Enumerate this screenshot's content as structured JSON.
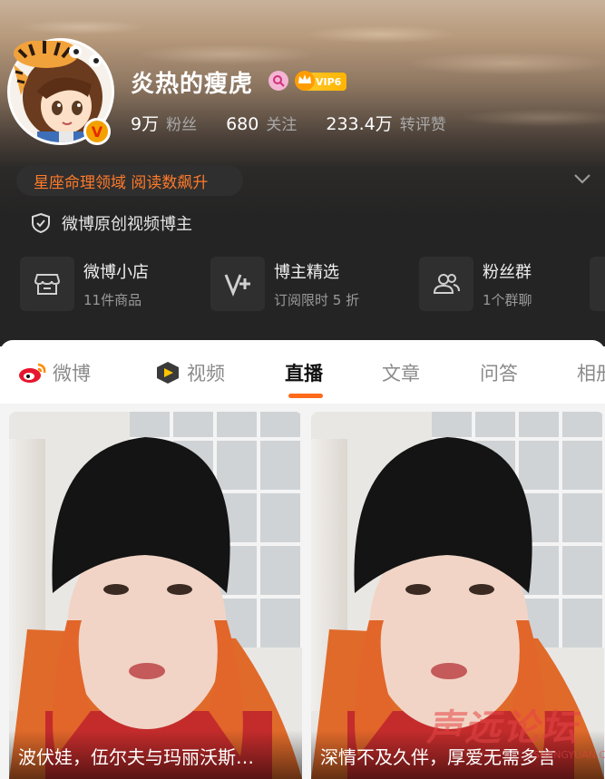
{
  "profile": {
    "username": "炎热的瘦虎",
    "vip_label": "VIP6",
    "verified_badge": "V",
    "stats": [
      {
        "value": "9万",
        "label": "粉丝"
      },
      {
        "value": "680",
        "label": "关注"
      },
      {
        "value": "233.4万",
        "label": "转评赞"
      }
    ],
    "tag": "星座命理领域 阅读数飙升",
    "verification": "微博原创视频博主"
  },
  "shortcuts": [
    {
      "title": "微博小店",
      "subtitle": "11件商品",
      "icon": "shop-icon"
    },
    {
      "title": "博主精选",
      "subtitle": "订阅限时 5 折",
      "icon": "v-plus-icon"
    },
    {
      "title": "粉丝群",
      "subtitle": "1个群聊",
      "icon": "group-icon"
    }
  ],
  "tabs": [
    {
      "label": "微博",
      "icon": "weibo-icon"
    },
    {
      "label": "视频",
      "icon": "video-icon"
    },
    {
      "label": "直播",
      "active": true
    },
    {
      "label": "文章"
    },
    {
      "label": "问答"
    },
    {
      "label": "相册"
    }
  ],
  "cards": [
    {
      "caption": "波伏娃，伍尔夫与玛丽沃斯…"
    },
    {
      "caption": "深情不及久伴，厚爱无需多言"
    }
  ],
  "watermark": {
    "text": "声远论坛",
    "sub": "SHENGYUAN.COM"
  },
  "colors": {
    "accent": "#ff6a1a",
    "tag_text": "#ff7a2a",
    "header_bg": "#242424",
    "vip_gold": "#ffb400"
  }
}
